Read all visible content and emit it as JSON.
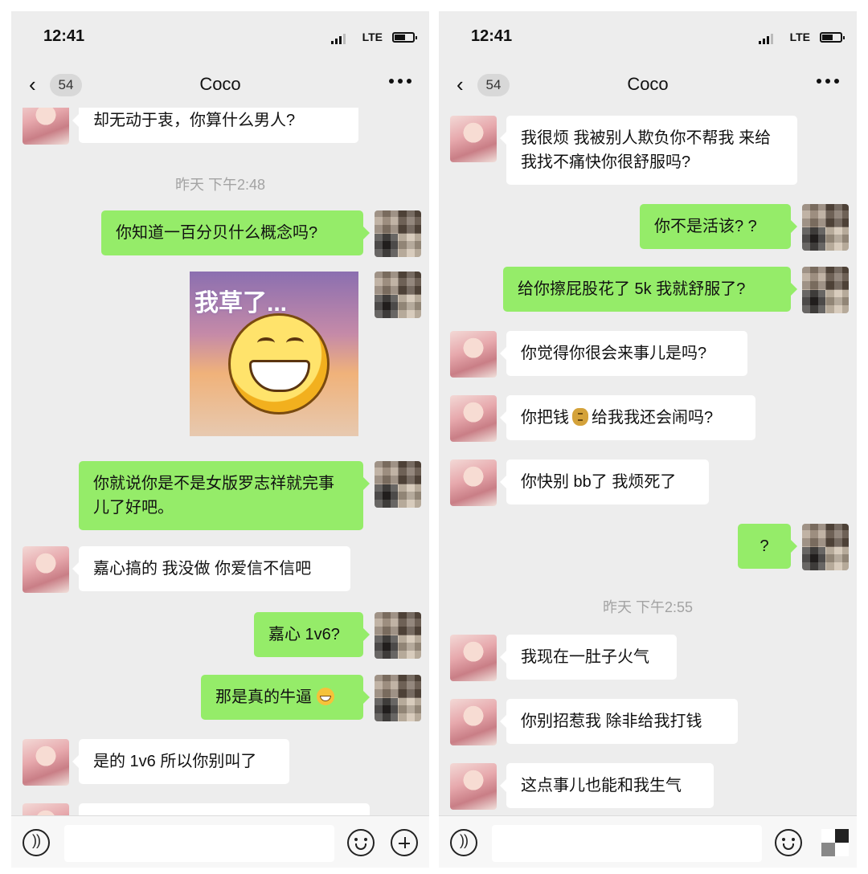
{
  "status": {
    "time": "12:41",
    "network": "LTE"
  },
  "nav": {
    "unread": "54",
    "title": "Coco"
  },
  "icons": {
    "back": "chevron-left-icon",
    "more": "more-dots-icon",
    "voice": "voice-icon",
    "emoji": "emoji-icon",
    "plus": "plus-icon",
    "signal": "signal-icon",
    "battery": "battery-icon"
  },
  "colors": {
    "outgoing_bubble": "#95ec69",
    "incoming_bubble": "#ffffff",
    "chat_bg": "#ededed"
  },
  "left": {
    "messages": [
      {
        "from": "her",
        "text": "却无动于衷，你算什么男人?"
      },
      {
        "type": "timestamp",
        "text": "昨天 下午2:48"
      },
      {
        "from": "me",
        "text": "你知道一百分贝什么概念吗?"
      },
      {
        "from": "me",
        "type": "sticker",
        "text": "我草了..."
      },
      {
        "from": "me",
        "text": "你就说你是不是女版罗志祥就完事儿了好吧。"
      },
      {
        "from": "her",
        "text": "嘉心搞的 我没做 你爱信不信吧"
      },
      {
        "from": "me",
        "text": "嘉心 1v6?"
      },
      {
        "from": "me",
        "text": "那是真的牛逼",
        "emoji": "grinning-face-icon"
      },
      {
        "from": "her",
        "text": "是的 1v6 所以你别叫了"
      }
    ]
  },
  "right": {
    "messages": [
      {
        "from": "her",
        "text": "我很烦 我被别人欺负你不帮我 来给我找不痛快你很舒服吗?"
      },
      {
        "from": "me",
        "text": "你不是活该? ?"
      },
      {
        "from": "me",
        "text": "给你擦屁股花了 5k 我就舒服了?"
      },
      {
        "from": "her",
        "text": "你觉得你很会来事儿是吗?"
      },
      {
        "from": "her",
        "text_before": "你把钱",
        "emoji": "money-bag-icon",
        "text_after": "给我我还会闹吗?"
      },
      {
        "from": "her",
        "text": "你快别 bb了 我烦死了"
      },
      {
        "from": "me",
        "text": "?"
      },
      {
        "type": "timestamp",
        "text": "昨天 下午2:55"
      },
      {
        "from": "her",
        "text": "我现在一肚子火气"
      },
      {
        "from": "her",
        "text": "你别招惹我 除非给我打钱"
      },
      {
        "from": "her",
        "text": "这点事儿也能和我生气"
      }
    ]
  }
}
